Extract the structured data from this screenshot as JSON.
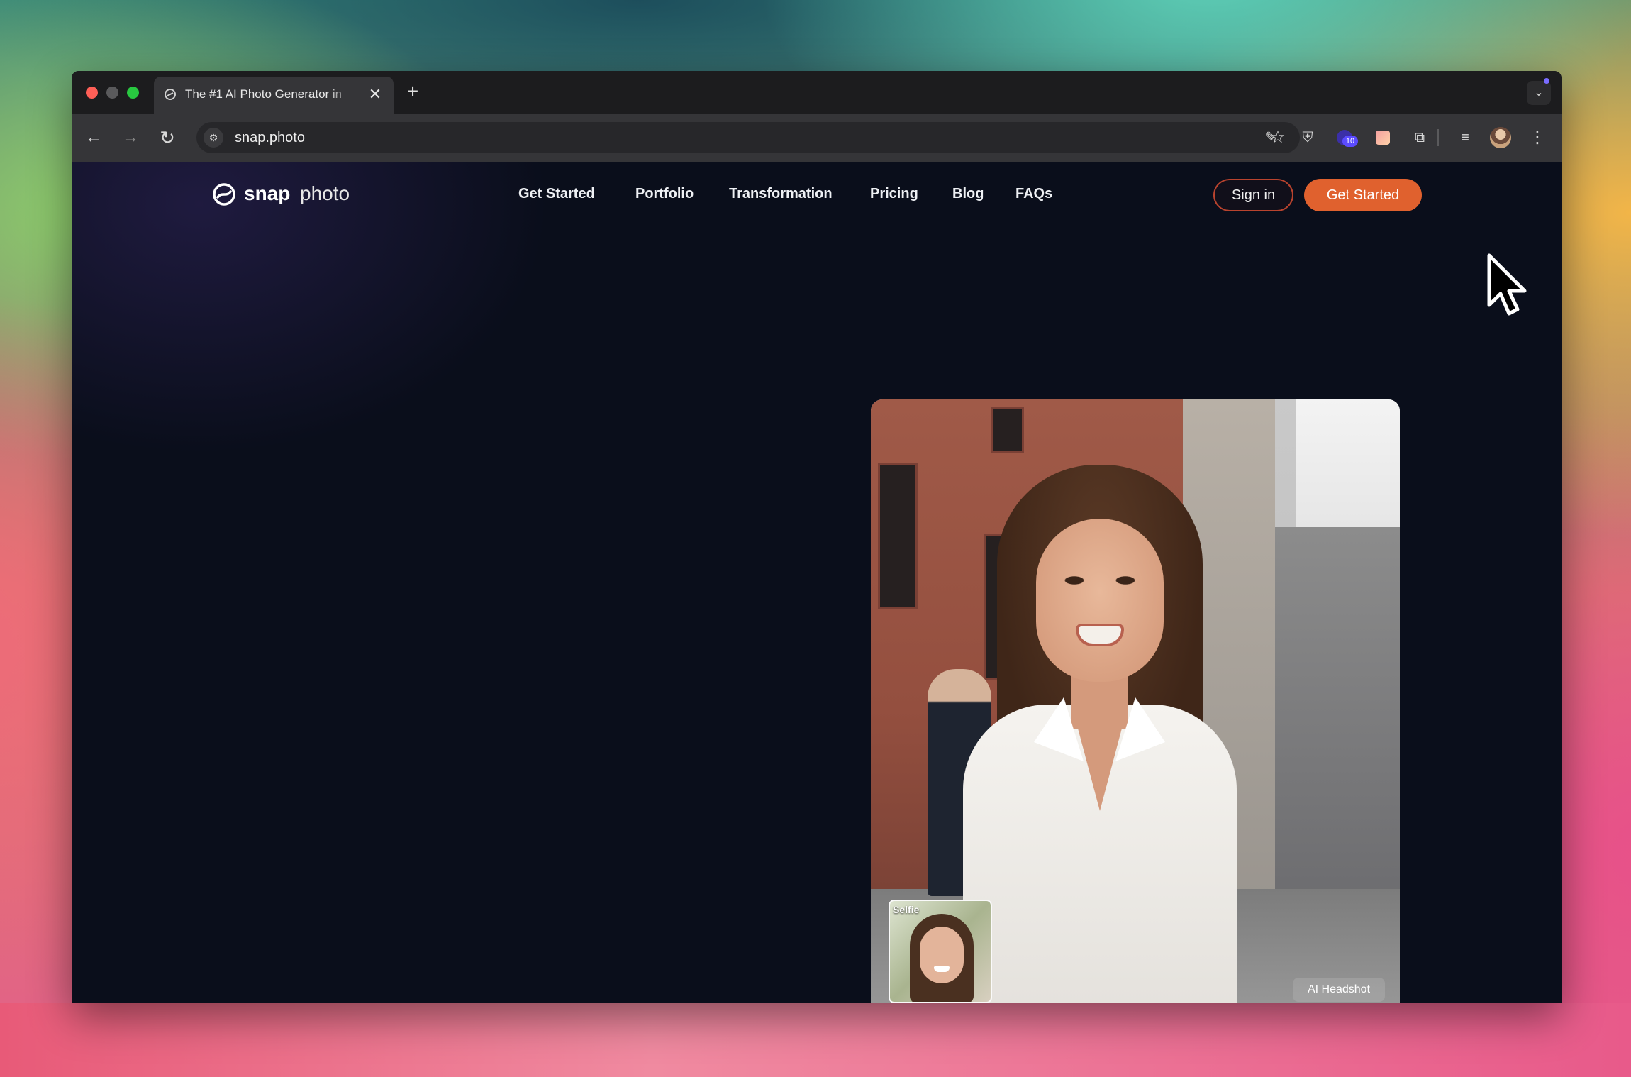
{
  "browser": {
    "tab": {
      "title": "The #1 AI Photo Generator in",
      "close_glyph": "✕",
      "favicon": "snap-photo-favicon-icon"
    },
    "new_tab_glyph": "+",
    "tab_menu_glyph": "⌄",
    "nav": {
      "back_glyph": "←",
      "forward_glyph": "→",
      "reload_glyph": "↻"
    },
    "address": {
      "url": "snap.photo",
      "site_settings_glyph": "⚙",
      "bookmark_glyph": "☆"
    },
    "extensions": {
      "pen_glyph": "✎",
      "shield_glyph": "⛨",
      "badge_count": "10",
      "puzzle_glyph": "⧉",
      "media_glyph": "≡",
      "menu_glyph": "⋮"
    }
  },
  "site": {
    "logo": {
      "bold": "snap",
      "light": "photo",
      "accent_color": "#ffffff"
    },
    "nav_links": [
      "Get Started",
      "Portfolio",
      "Transformation",
      "Pricing",
      "Blog",
      "FAQs"
    ],
    "sign_in_label": "Sign in",
    "cta_label": "Get Started",
    "colors": {
      "cta": "#e0612e",
      "sign_in_border": "#b9432e",
      "page_background": "#0a0e1b"
    },
    "hero": {
      "selfie_label": "Selfie",
      "result_label": "AI Headshot"
    }
  }
}
